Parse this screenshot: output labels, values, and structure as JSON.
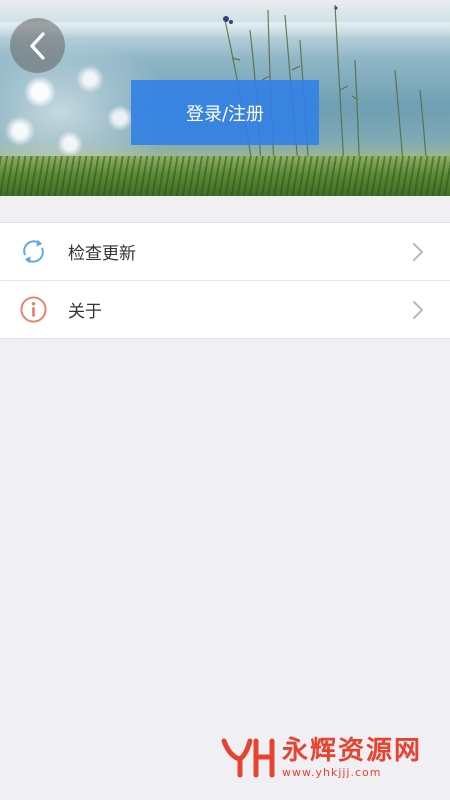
{
  "header": {
    "back_icon": "chevron-left-icon",
    "login_label": "登录/注册"
  },
  "menu": {
    "items": [
      {
        "label": "检查更新",
        "icon": "refresh-icon",
        "icon_color": "#5aa9e6"
      },
      {
        "label": "关于",
        "icon": "info-icon",
        "icon_color": "#e9806c"
      }
    ]
  },
  "watermark": {
    "title": "永辉资源网",
    "url": "www.yhkjjj.com",
    "color": "#e8432f"
  }
}
